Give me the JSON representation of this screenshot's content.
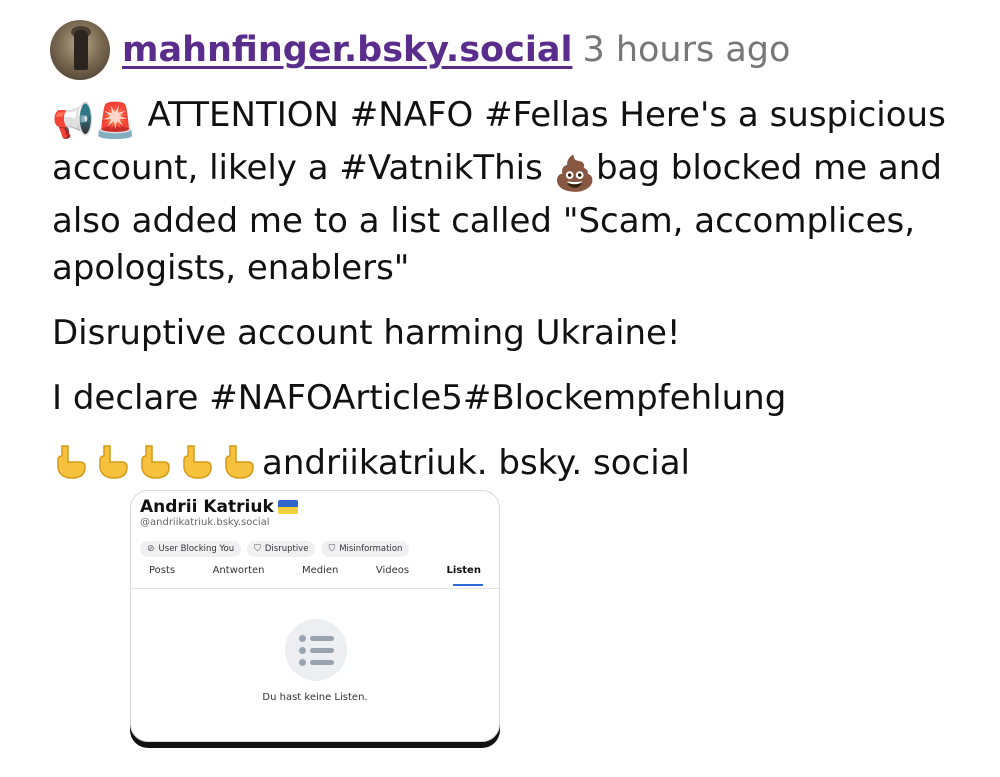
{
  "post": {
    "author": "mahnfinger.bsky.social",
    "time": "3 hours ago",
    "line1": " ATTENTION #NAFO #Fellas Here's a suspicious account, likely a #VatnikThis ",
    "line1_tail": "bag blocked me and also added me to a list called \"Scam, accomplices, apologists, enablers\"",
    "para2": "Disruptive account harming Ukraine!",
    "para3": "I declare #NAFOArticle5#Blockempfehlung",
    "para4": "andriikatriuk. bsky. social",
    "emoji": {
      "megaphone": "📢",
      "siren": "🚨",
      "poo": "💩"
    }
  },
  "card": {
    "name": "Andrii Katriuk",
    "handle": "@andriikatriuk.bsky.social",
    "badges": [
      "User Blocking You",
      "Disruptive",
      "Misinformation"
    ],
    "tabs": [
      "Posts",
      "Antworten",
      "Medien",
      "Videos",
      "Listen"
    ],
    "active_tab": "Listen",
    "empty_text": "Du hast keine Listen."
  }
}
